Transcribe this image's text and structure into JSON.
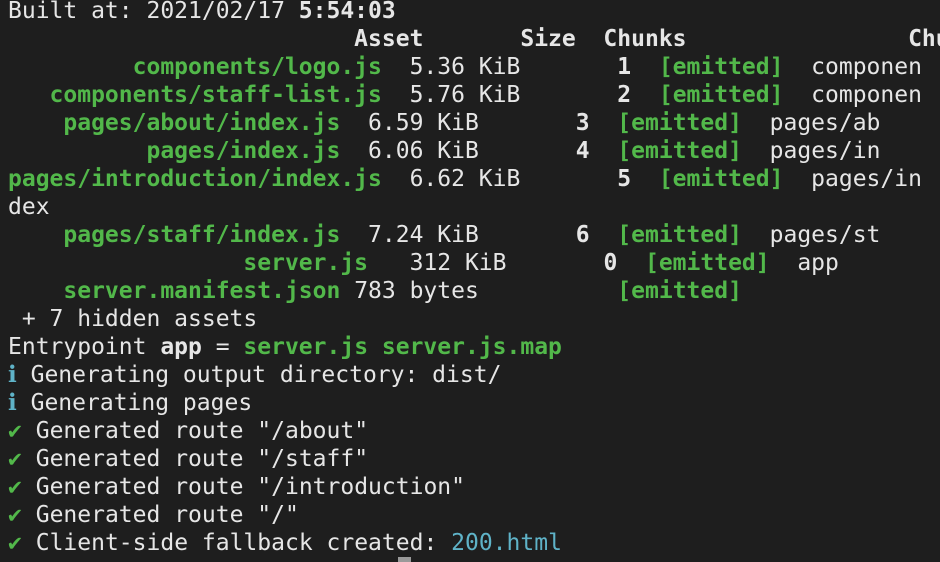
{
  "build": {
    "label": "Built at: 2021/02/17 ",
    "time": "5:54:03"
  },
  "table": {
    "header": "                         Asset       Size  Chunks                Chunk Na",
    "rows": [
      {
        "pad": "         ",
        "asset": "components/logo.js",
        "size": "  5.36 KiB",
        "chunk": "       1",
        "status": "  [emitted]",
        "name": "  componen"
      },
      {
        "pad": "   ",
        "asset": "components/staff-list.js",
        "size": "  5.76 KiB",
        "chunk": "       2",
        "status": "  [emitted]",
        "name": "  componen"
      },
      {
        "pad": "    ",
        "asset": "pages/about/index.js",
        "size": "  6.59 KiB",
        "chunk": "       3",
        "status": "  [emitted]",
        "name": "  pages/ab"
      },
      {
        "pad": "          ",
        "asset": "pages/index.js",
        "size": "  6.06 KiB",
        "chunk": "       4",
        "status": "  [emitted]",
        "name": "  pages/in"
      },
      {
        "pad": "",
        "asset": "pages/introduction/index.js",
        "size": "  6.62 KiB",
        "chunk": "       5",
        "status": "  [emitted]",
        "name": "  pages/in"
      },
      {
        "wrap": "dex"
      },
      {
        "pad": "    ",
        "asset": "pages/staff/index.js",
        "size": "  7.24 KiB",
        "chunk": "       6",
        "status": "  [emitted]",
        "name": "  pages/st"
      },
      {
        "pad": "                 ",
        "asset": "server.js",
        "size": "   312 KiB",
        "chunk": "       0",
        "status": "  [emitted]",
        "name": "  app"
      },
      {
        "pad": "    ",
        "asset": "server.manifest.json",
        "size": " 783 bytes",
        "chunk": "        ",
        "status": "  [emitted]",
        "name": ""
      }
    ]
  },
  "hidden": " + 7 hidden assets",
  "entry": {
    "label": "Entrypoint ",
    "name": "app",
    "eq": " = ",
    "files": "server.js server.js.map"
  },
  "info_glyph": "ℹ",
  "check_glyph": "✔",
  "info_lines": [
    "Generating output directory: dist/",
    "Generating pages"
  ],
  "check_lines": [
    "Generated route \"/about\"",
    "Generated route \"/staff\"",
    "Generated route \"/introduction\"",
    "Generated route \"/\""
  ],
  "fallback": {
    "label": "Client-side fallback created: ",
    "file": "200.html"
  }
}
